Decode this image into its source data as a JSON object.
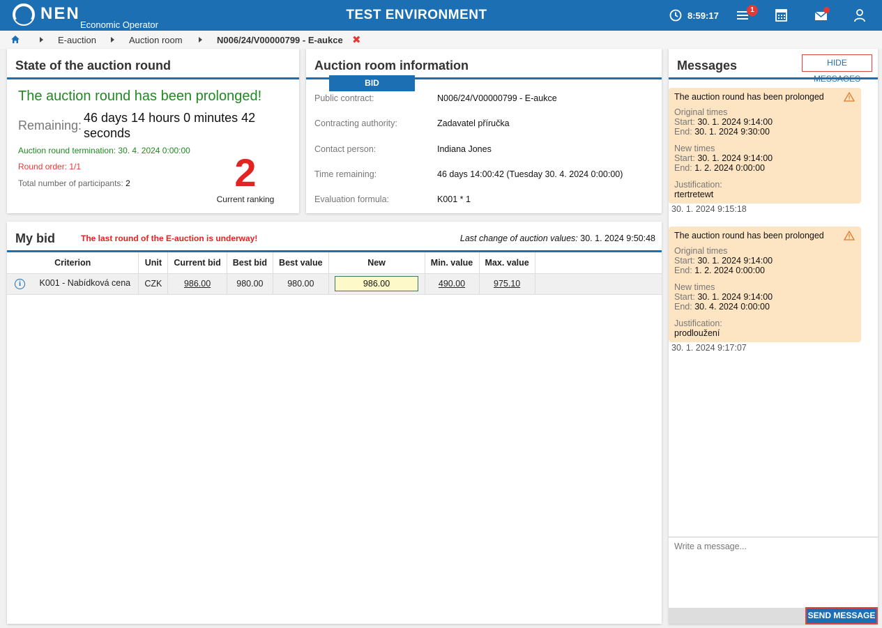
{
  "header": {
    "logo_text": "NEN",
    "logo_subtitle": "Economic Operator",
    "env_title": "TEST ENVIRONMENT",
    "clock": "8:59:17",
    "menu_badge": "1"
  },
  "breadcrumb": {
    "items": [
      "E-auction",
      "Auction room",
      "N006/24/V00000799 - E-aukce"
    ],
    "close_symbol": "✖"
  },
  "state_panel": {
    "title": "State of the auction round",
    "headline": "The auction round has been prolonged!",
    "remaining_label": "Remaining:",
    "remaining_value": "46 days 14 hours 0 minutes 42 seconds",
    "termination": "Auction round termination: 30. 4. 2024 0:00:00",
    "round_order": "Round order: 1/1",
    "participants_label": "Total number of participants:",
    "participants_value": "2",
    "ranking_value": "2",
    "ranking_label": "Current ranking"
  },
  "room_panel": {
    "title": "Auction room information",
    "rows": [
      {
        "label": "Public contract:",
        "value": "N006/24/V00000799 - E-aukce"
      },
      {
        "label": "Contracting authority:",
        "value": "Zadavatel příručka"
      },
      {
        "label": "Contact person:",
        "value": "Indiana Jones"
      },
      {
        "label": "Time remaining:",
        "value": "46 days 14:00:42 (Tuesday 30. 4. 2024 0:00:00)"
      },
      {
        "label": "Evaluation formula:",
        "value": "K001 * 1"
      }
    ]
  },
  "bid_panel": {
    "title": "My bid",
    "warning": "The last round of the E-auction is underway!",
    "last_change_label": "Last change of auction values:",
    "last_change_value": "30. 1. 2024 9:50:48",
    "columns": [
      "Criterion",
      "Unit",
      "Current bid",
      "Best bid",
      "Best value",
      "New",
      "Min. value",
      "Max. value"
    ],
    "row": {
      "info_symbol": "i",
      "criterion": "K001 - Nabídková cena",
      "unit": "CZK",
      "current_bid": "986.00",
      "best_bid": "980.00",
      "best_value": "980.00",
      "new_value": "986.00",
      "min_value": "490.00",
      "max_value": "975.10"
    },
    "bid_button": "BID"
  },
  "messages": {
    "title": "Messages",
    "hide_button": "HIDE MESSAGES",
    "items": [
      {
        "heading": "The auction round has been prolonged",
        "original_label": "Original times",
        "original_start_label": "Start:",
        "original_start": "30. 1. 2024 9:14:00",
        "original_end_label": "End:",
        "original_end": "30. 1. 2024 9:30:00",
        "new_label": "New times",
        "new_start_label": "Start:",
        "new_start": "30. 1. 2024 9:14:00",
        "new_end_label": "End:",
        "new_end": "1. 2. 2024 0:00:00",
        "justification_label": "Justification:",
        "justification": "rtertretewt",
        "timestamp": "30. 1. 2024 9:15:18"
      },
      {
        "heading": "The auction round has been prolonged",
        "original_label": "Original times",
        "original_start_label": "Start:",
        "original_start": "30. 1. 2024 9:14:00",
        "original_end_label": "End:",
        "original_end": "1. 2. 2024 0:00:00",
        "new_label": "New times",
        "new_start_label": "Start:",
        "new_start": "30. 1. 2024 9:14:00",
        "new_end_label": "End:",
        "new_end": "30. 4. 2024 0:00:00",
        "justification_label": "Justification:",
        "justification": "prodloužení",
        "timestamp": "30. 1. 2024 9:17:07"
      }
    ],
    "compose_placeholder": "Write a message...",
    "send_button": "SEND MESSAGE"
  },
  "colors": {
    "brand": "#1d6fb3",
    "success": "#1f8a1f",
    "danger": "#e52222",
    "message_bg": "#fde4c3",
    "input_highlight": "#fef9c8"
  }
}
